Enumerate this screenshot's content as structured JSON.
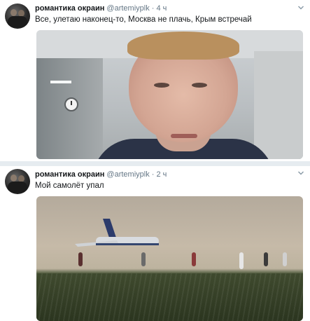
{
  "tweets": [
    {
      "name": "романтика окраин",
      "handle": "@artemiyplk",
      "separator": "·",
      "time": "4 ч",
      "text": "Все, улетаю наконец-то, Москва не плачь, Крым встречай"
    },
    {
      "name": "романтика окраин",
      "handle": "@artemiyplk",
      "separator": "·",
      "time": "2 ч",
      "text": "Мой самолёт упал"
    }
  ],
  "icons": {
    "menu": "chevron-down-icon",
    "avatar": "profile-avatar"
  },
  "colors": {
    "name": "#14171a",
    "meta": "#657786",
    "divider": "#e6ecf0"
  }
}
